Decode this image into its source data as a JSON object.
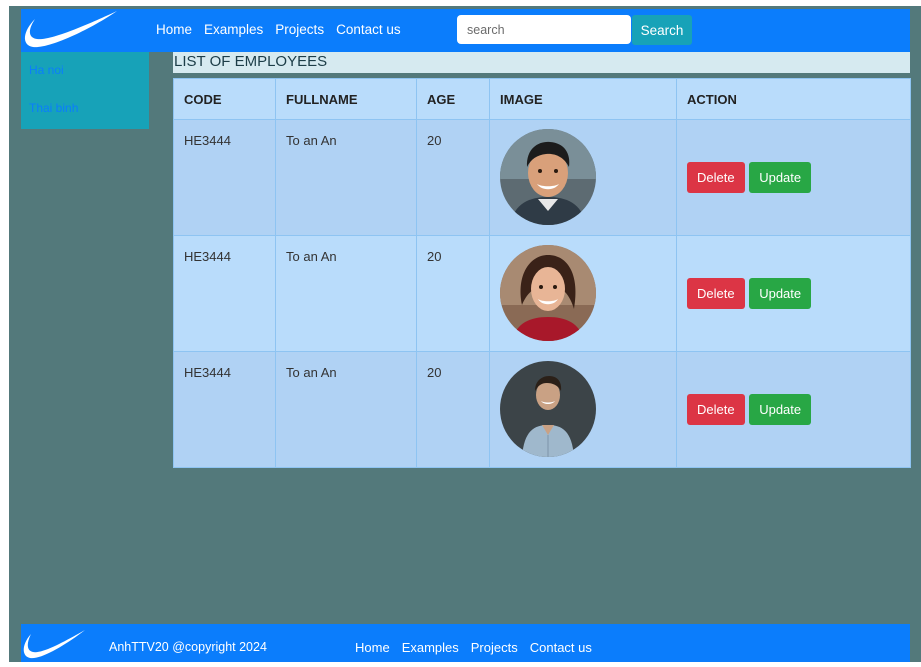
{
  "navbar": {
    "logo_icon": "swoosh-logo-icon",
    "links": [
      "Home",
      "Examples",
      "Projects",
      "Contact us"
    ],
    "search_placeholder": "search",
    "search_value": "",
    "search_button": "Search"
  },
  "sidebar": {
    "items": [
      "Ha noi",
      "Thai binh"
    ]
  },
  "main": {
    "title": "LIST OF EMPLOYEES",
    "table": {
      "headers": [
        "CODE",
        "FULLNAME",
        "AGE",
        "IMAGE",
        "ACTION"
      ],
      "rows": [
        {
          "code": "HE3444",
          "fullname": "To an An",
          "age": "20",
          "image": "male-smiling-portrait",
          "delete": "Delete",
          "update": "Update"
        },
        {
          "code": "HE3444",
          "fullname": "To an An",
          "age": "20",
          "image": "female-smiling-portrait",
          "delete": "Delete",
          "update": "Update"
        },
        {
          "code": "HE3444",
          "fullname": "To an An",
          "age": "20",
          "image": "male-shirt-portrait",
          "delete": "Delete",
          "update": "Update"
        }
      ]
    }
  },
  "footer": {
    "logo_icon": "swoosh-logo-icon",
    "copyright": "AnhTTV20 @copyright 2024",
    "links": [
      "Home",
      "Examples",
      "Projects",
      "Contact us"
    ]
  },
  "colors": {
    "navbar": "#0b7dfc",
    "page_background": "#53797b",
    "sidebar": "#17a2b8",
    "delete": "#dc3545",
    "update": "#28a745"
  }
}
